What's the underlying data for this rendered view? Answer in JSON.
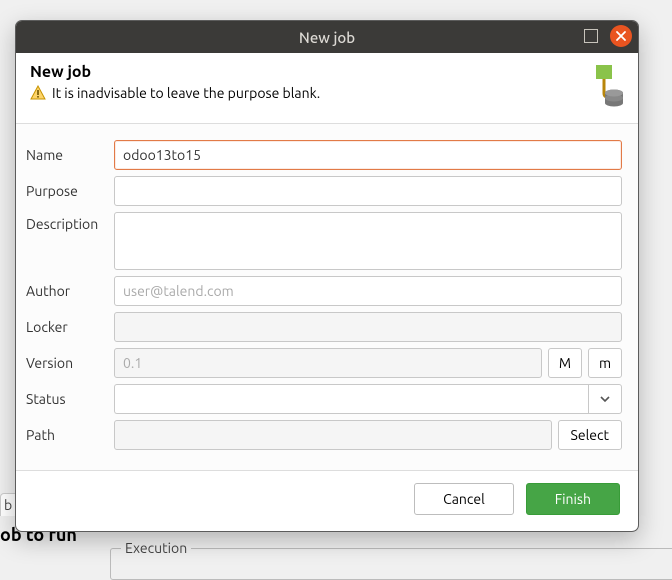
{
  "bg": {
    "tab": "b",
    "heading": "ob to run",
    "fieldset": "Execution"
  },
  "titlebar": {
    "title": "New job"
  },
  "header": {
    "title": "New job",
    "warning": "It is inadvisable to leave the purpose blank."
  },
  "form": {
    "name": {
      "label": "Name",
      "value": "odoo13to15"
    },
    "purpose": {
      "label": "Purpose",
      "value": ""
    },
    "description": {
      "label": "Description",
      "value": ""
    },
    "author": {
      "label": "Author",
      "placeholder": "user@talend.com",
      "value": ""
    },
    "locker": {
      "label": "Locker",
      "value": ""
    },
    "version": {
      "label": "Version",
      "placeholder": "0.1",
      "value": "",
      "major": "M",
      "minor": "m"
    },
    "status": {
      "label": "Status",
      "value": ""
    },
    "path": {
      "label": "Path",
      "value": "",
      "select": "Select"
    }
  },
  "footer": {
    "cancel": "Cancel",
    "finish": "Finish"
  },
  "icons": {
    "db": "database-icon",
    "warn": "warning-icon",
    "chevron": "chevron-down-icon",
    "max": "maximize-icon",
    "close": "close-icon"
  }
}
